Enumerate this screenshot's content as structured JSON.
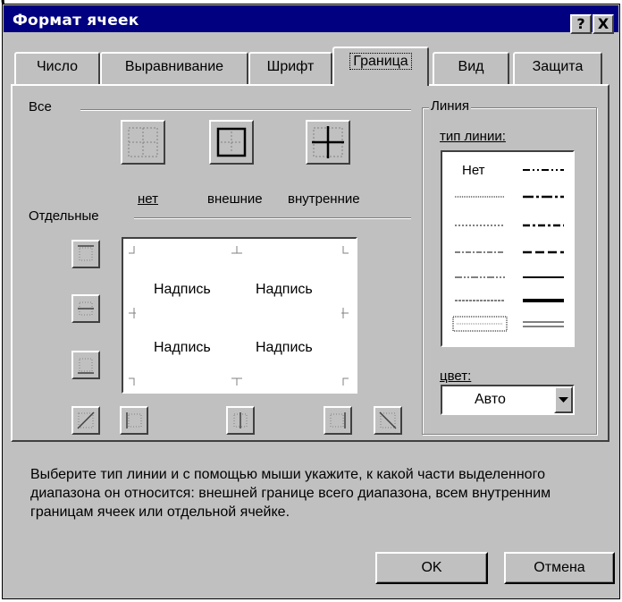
{
  "title": "Формат ячеек",
  "title_buttons": {
    "help": "?",
    "close": "X"
  },
  "tabs": [
    "Число",
    "Выравнивание",
    "Шрифт",
    "Граница",
    "Вид",
    "Защита"
  ],
  "active_tab": "Граница",
  "groups": {
    "all": "Все",
    "separate": "Отдельные",
    "line": "Линия"
  },
  "presets": {
    "none": "нет",
    "outer": "внешние",
    "inner": "внутренние"
  },
  "preview_text": [
    "Надпись",
    "Надпись",
    "Надпись",
    "Надпись"
  ],
  "line_type_label": "тип линии:",
  "line_none": "Нет",
  "color_label": "цвет:",
  "color_value": "Авто",
  "hint": "Выберите тип линии и с помощью мыши укажите, к какой части выделенного диапазона он относится: внешней границе всего диапазона, всем внутренним границам ячеек или отдельной ячейке.",
  "buttons": {
    "ok": "OK",
    "cancel": "Отмена"
  },
  "colors": {
    "titlebar": "#000080",
    "face": "#c0c0c0"
  },
  "icons": [
    "help-icon",
    "close-icon",
    "dropdown-arrow-icon"
  ]
}
